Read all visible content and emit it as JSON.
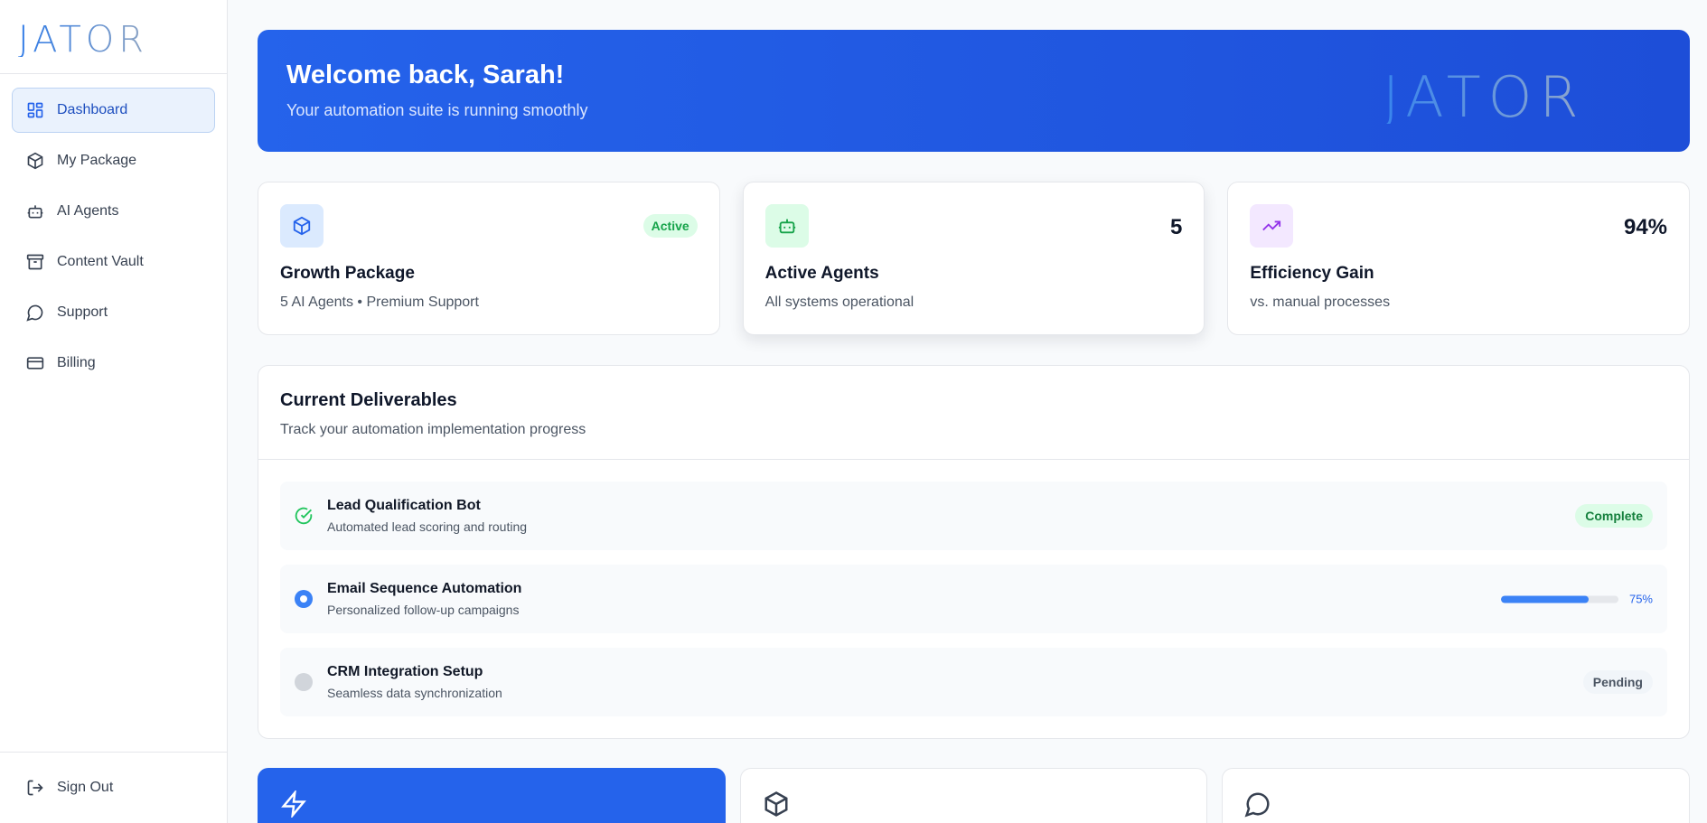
{
  "brand": {
    "logo_text": "JATOR",
    "colors": {
      "primary": "#2563eb",
      "logo_gradient_start": "#3b82f6",
      "logo_gradient_end": "#8aa3c4"
    }
  },
  "sidebar": {
    "items": [
      {
        "label": "Dashboard",
        "icon": "dashboard-icon",
        "active": true
      },
      {
        "label": "My Package",
        "icon": "package-icon"
      },
      {
        "label": "AI Agents",
        "icon": "bot-icon"
      },
      {
        "label": "Content Vault",
        "icon": "archive-icon"
      },
      {
        "label": "Support",
        "icon": "chat-icon"
      },
      {
        "label": "Billing",
        "icon": "credit-card-icon"
      }
    ],
    "sign_out": {
      "label": "Sign Out",
      "icon": "sign-out-icon"
    }
  },
  "hero": {
    "title": "Welcome back, Sarah!",
    "subtitle": "Your automation suite is running smoothly",
    "logo_text": "JATOR"
  },
  "stats": [
    {
      "icon": "package-icon",
      "title": "Growth Package",
      "subtitle": "5 AI Agents • Premium Support",
      "badge": "Active",
      "icon_bg": "#dbeafe",
      "icon_color": "#2563eb"
    },
    {
      "icon": "bot-icon",
      "title": "Active Agents",
      "subtitle": "All systems operational",
      "value": "5",
      "icon_bg": "#dcfce7",
      "icon_color": "#16a34a"
    },
    {
      "icon": "trending-up-icon",
      "title": "Efficiency Gain",
      "subtitle": "vs. manual processes",
      "value": "94%",
      "icon_bg": "#f3e8ff",
      "icon_color": "#9333ea"
    }
  ],
  "deliverables": {
    "title": "Current Deliverables",
    "subtitle": "Track your automation implementation progress",
    "items": [
      {
        "title": "Lead Qualification Bot",
        "subtitle": "Automated lead scoring and routing",
        "status": "Complete",
        "status_icon": "check-circle-icon"
      },
      {
        "title": "Email Sequence Automation",
        "subtitle": "Personalized follow-up campaigns",
        "progress": 0.75,
        "progress_label": "75%",
        "status_icon": "in-progress-icon"
      },
      {
        "title": "CRM Integration Setup",
        "subtitle": "Seamless data synchronization",
        "status": "Pending",
        "status_icon": "pending-icon"
      }
    ]
  },
  "quick_actions": [
    {
      "icon": "lightning-icon"
    },
    {
      "icon": "package-icon"
    },
    {
      "icon": "chat-icon"
    }
  ]
}
